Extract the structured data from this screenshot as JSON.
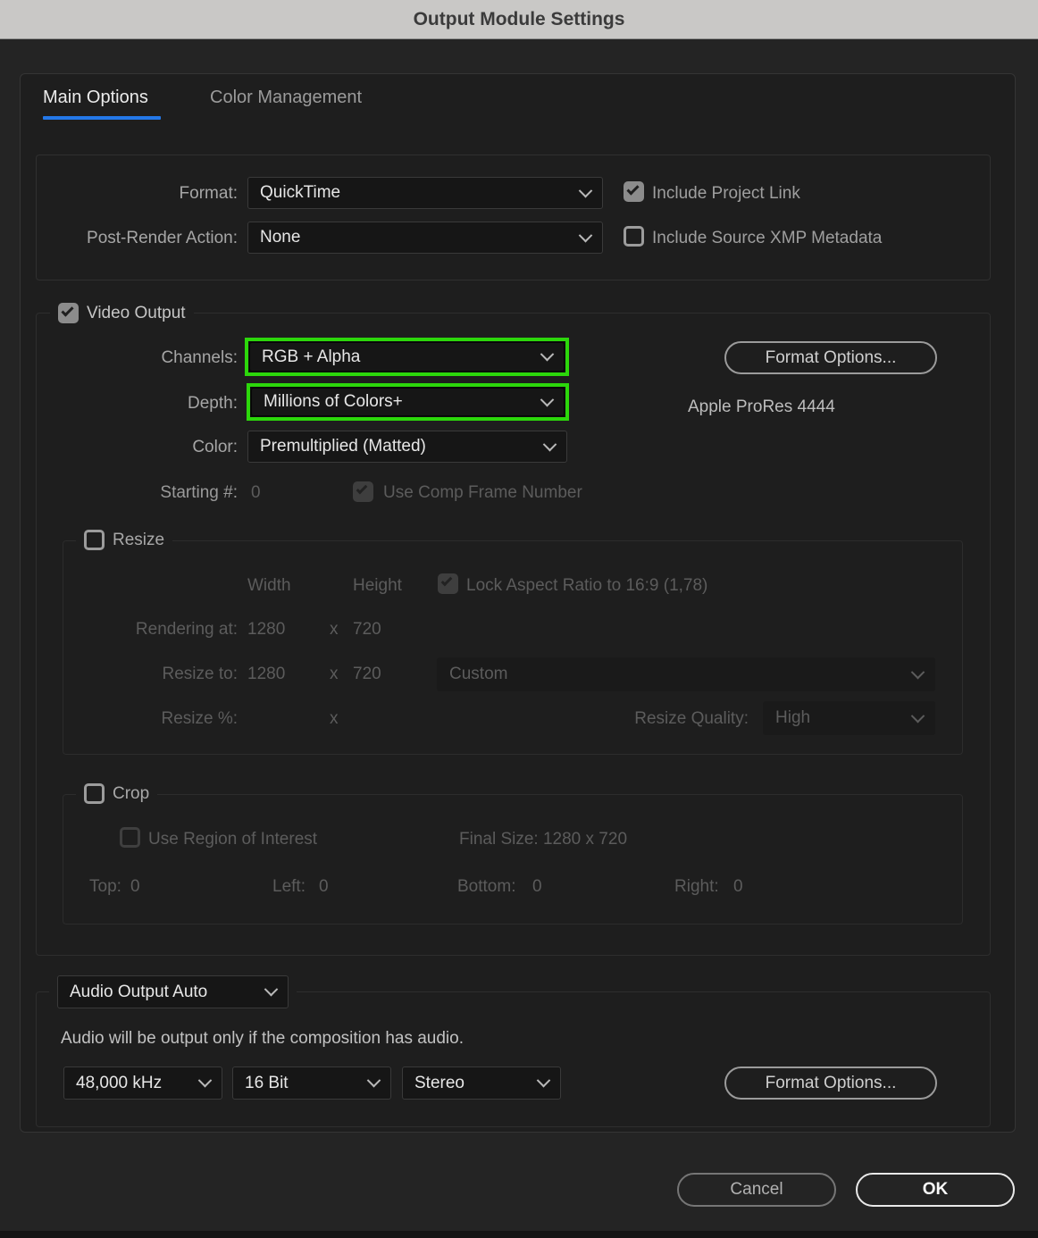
{
  "window": {
    "title": "Output Module Settings"
  },
  "tabs": [
    {
      "label": "Main Options",
      "active": true
    },
    {
      "label": "Color Management",
      "active": false
    }
  ],
  "format_section": {
    "format_label": "Format:",
    "format_value": "QuickTime",
    "post_render_label": "Post-Render Action:",
    "post_render_value": "None",
    "include_project_link_label": "Include Project Link",
    "include_project_link_checked": true,
    "include_xmp_label": "Include Source XMP Metadata",
    "include_xmp_checked": false
  },
  "video_output": {
    "label": "Video Output",
    "checked": true,
    "channels_label": "Channels:",
    "channels_value": "RGB + Alpha",
    "depth_label": "Depth:",
    "depth_value": "Millions of Colors+",
    "color_label": "Color:",
    "color_value": "Premultiplied (Matted)",
    "starting_label": "Starting #:",
    "starting_value": "0",
    "use_comp_frame_label": "Use Comp Frame Number",
    "use_comp_frame_checked": true,
    "format_options_button": "Format Options...",
    "codec_info": "Apple ProRes 4444"
  },
  "resize": {
    "label": "Resize",
    "checked": false,
    "width_header": "Width",
    "height_header": "Height",
    "lock_aspect_label": "Lock Aspect Ratio to 16:9 (1,78)",
    "lock_aspect_checked": true,
    "rendering_at_label": "Rendering at:",
    "rendering_width": "1280",
    "rendering_x": "x",
    "rendering_height": "720",
    "resize_to_label": "Resize to:",
    "resize_width": "1280",
    "resize_x": "x",
    "resize_height": "720",
    "preset_value": "Custom",
    "resize_pct_label": "Resize %:",
    "resize_pct_x": "x",
    "quality_label": "Resize Quality:",
    "quality_value": "High"
  },
  "crop": {
    "label": "Crop",
    "checked": false,
    "use_roi_label": "Use Region of Interest",
    "use_roi_checked": false,
    "final_size": "Final Size: 1280 x 720",
    "top_label": "Top:",
    "top_value": "0",
    "left_label": "Left:",
    "left_value": "0",
    "bottom_label": "Bottom:",
    "bottom_value": "0",
    "right_label": "Right:",
    "right_value": "0"
  },
  "audio": {
    "mode_value": "Audio Output Auto",
    "note": "Audio will be output only if the composition has audio.",
    "sample_rate_value": "48,000 kHz",
    "bit_depth_value": "16 Bit",
    "channels_value": "Stereo",
    "format_options_button": "Format Options..."
  },
  "footer": {
    "cancel": "Cancel",
    "ok": "OK"
  },
  "colors": {
    "highlight_green": "#2cd70b",
    "tab_accent_blue": "#2478e8",
    "titlebar_bg": "#c9c8c6"
  }
}
